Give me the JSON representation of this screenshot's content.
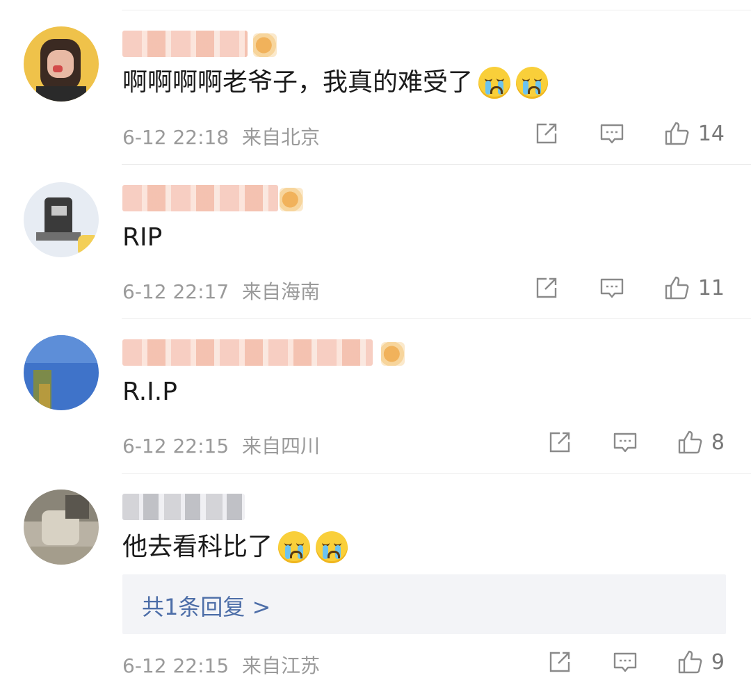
{
  "comments": [
    {
      "text": "啊啊啊啊老爷子，我真的难受了",
      "emoji_count": 2,
      "time": "6-12 22:18",
      "location": "来自北京",
      "likes": "14"
    },
    {
      "text": "RIP",
      "emoji_count": 0,
      "time": "6-12 22:17",
      "location": "来自海南",
      "likes": "11"
    },
    {
      "text": "R.I.P",
      "emoji_count": 0,
      "time": "6-12 22:15",
      "location": "来自四川",
      "likes": "8"
    },
    {
      "text": "他去看科比了",
      "emoji_count": 2,
      "time": "6-12 22:15",
      "location": "来自江苏",
      "likes": "9",
      "replies_label": "共1条回复 >"
    }
  ],
  "icons": {
    "share": "share-icon",
    "reply": "comment-icon",
    "like": "thumbs-up-icon",
    "emoji": "crying-face-emoji"
  },
  "colors": {
    "meta_text": "#9a9a9a",
    "reply_link": "#4d6ea8",
    "reply_box_bg": "#f3f4f7",
    "divider": "#ececec"
  }
}
